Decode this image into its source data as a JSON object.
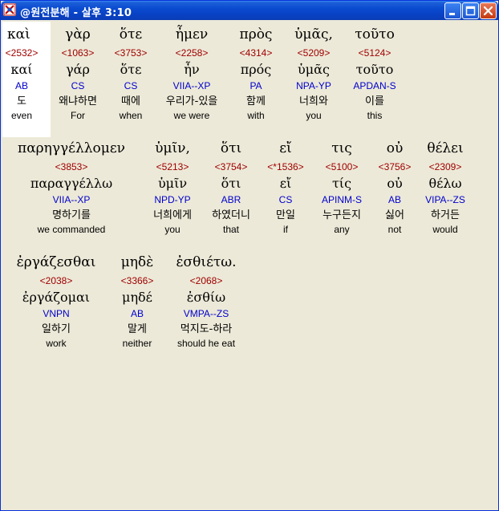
{
  "window": {
    "title": "@원전분해 - 살후 3:10",
    "controls": {
      "minimize_icon": "minimize-icon",
      "maximize_icon": "maximize-icon",
      "close_icon": "close-icon"
    }
  },
  "colors": {
    "titlebar": "#0a4bd0",
    "background": "#ece9d8",
    "strongs_number": "#a00000",
    "parsing": "#0000cc",
    "selected_background": "#ffffff"
  },
  "rows": [
    {
      "words": [
        {
          "greek": "καὶ",
          "strongs": "<2532>",
          "lemma": "καί",
          "parsing": "AB",
          "korean": "도",
          "english": "even",
          "selected": true
        },
        {
          "greek": "γὰρ",
          "strongs": "<1063>",
          "lemma": "γάρ",
          "parsing": "CS",
          "korean": "왜냐하면",
          "english": "For"
        },
        {
          "greek": "ὅτε",
          "strongs": "<3753>",
          "lemma": "ὅτε",
          "parsing": "CS",
          "korean": "때에",
          "english": "when"
        },
        {
          "greek": "ἦμεν",
          "strongs": "<2258>",
          "lemma": "ἦν",
          "parsing": "VIIA--XP",
          "korean": "우리가-있을",
          "english": "we were"
        },
        {
          "greek": "πρὸς",
          "strongs": "<4314>",
          "lemma": "πρός",
          "parsing": "PA",
          "korean": "함께",
          "english": "with"
        },
        {
          "greek": "ὑμᾶς,",
          "strongs": "<5209>",
          "lemma": "ὑμᾶς",
          "parsing": "NPA-YP",
          "korean": "너희와",
          "english": "you"
        },
        {
          "greek": "τοῦτο",
          "strongs": "<5124>",
          "lemma": "τοῦτο",
          "parsing": "APDAN-S",
          "korean": "이를",
          "english": "this"
        }
      ]
    },
    {
      "words": [
        {
          "greek": "παρηγγέλλομεν",
          "strongs": "<3853>",
          "lemma": "παραγγέλλω",
          "parsing": "VIIA--XP",
          "korean": "명하기를",
          "english": "we commanded"
        },
        {
          "greek": "ὑμῖν,",
          "strongs": "<5213>",
          "lemma": "ὑμῖν",
          "parsing": "NPD-YP",
          "korean": "너희에게",
          "english": "you"
        },
        {
          "greek": "ὅτι",
          "strongs": "<3754>",
          "lemma": "ὅτι",
          "parsing": "ABR",
          "korean": "하였더니",
          "english": "that"
        },
        {
          "greek": "εἴ",
          "strongs": "<*1536>",
          "lemma": "εἴ",
          "parsing": "CS",
          "korean": "만일",
          "english": "if"
        },
        {
          "greek": "τις",
          "strongs": "<5100>",
          "lemma": "τίς",
          "parsing": "APINM-S",
          "korean": "누구든지",
          "english": "any"
        },
        {
          "greek": "οὐ",
          "strongs": "<3756>",
          "lemma": "οὐ",
          "parsing": "AB",
          "korean": "싫어",
          "english": "not"
        },
        {
          "greek": "θέλει",
          "strongs": "<2309>",
          "lemma": "θέλω",
          "parsing": "VIPA--ZS",
          "korean": "하거든",
          "english": "would"
        }
      ]
    },
    {
      "words": [
        {
          "greek": "ἐργάζεσθαι",
          "strongs": "<2038>",
          "lemma": "ἐργάζομαι",
          "parsing": "VNPN",
          "korean": "일하기",
          "english": "work"
        },
        {
          "greek": "μηδὲ",
          "strongs": "<3366>",
          "lemma": "μηδέ",
          "parsing": "AB",
          "korean": "말게",
          "english": "neither"
        },
        {
          "greek": "ἐσθιέτω.",
          "strongs": "<2068>",
          "lemma": "ἐσθίω",
          "parsing": "VMPA--ZS",
          "korean": "먹지도-하라",
          "english": "should he eat"
        }
      ]
    }
  ]
}
